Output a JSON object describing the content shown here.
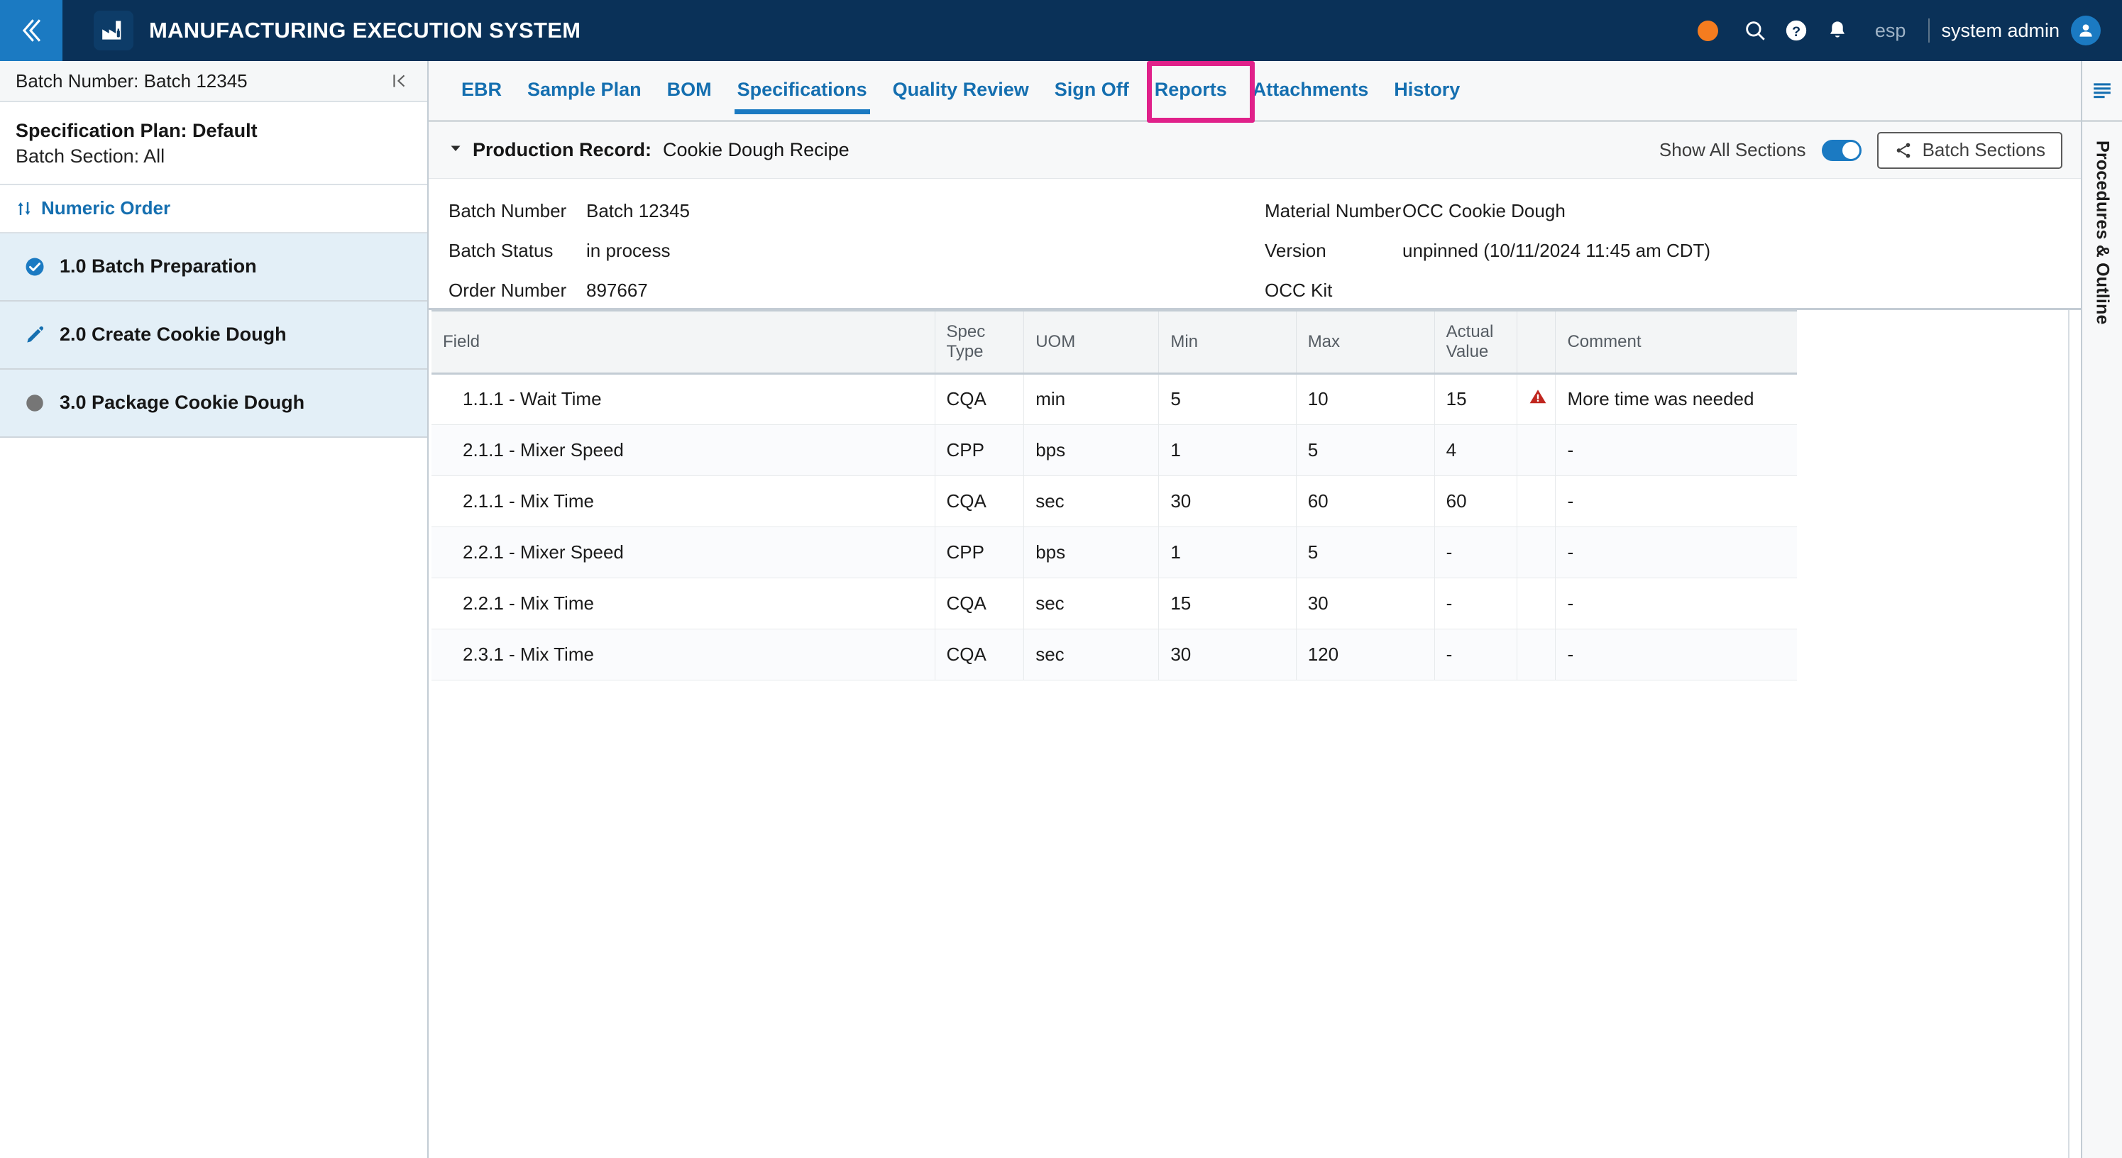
{
  "header": {
    "app_title": "MANUFACTURING EXECUTION SYSTEM",
    "collapse_icon": "chevron-double-left-icon",
    "logo_icon": "factory-icon",
    "status_dot_color": "#f57c1f",
    "search_icon": "search-icon",
    "help_icon": "help-circle-icon",
    "notifications_icon": "bell-icon",
    "language": "esp",
    "username": "system admin",
    "avatar_icon": "user-avatar-icon"
  },
  "sidebar": {
    "batch_bar_label": "Batch Number: Batch 12345",
    "collapse_icon": "collapse-panel-left-icon",
    "plan_title": "Specification Plan: Default",
    "plan_section": "Batch Section: All",
    "sort_label": "Numeric Order",
    "sort_icon": "sort-arrows-icon",
    "items": [
      {
        "label": "1.0 Batch Preparation",
        "icon": "check-circle-icon",
        "status": "complete"
      },
      {
        "label": "2.0 Create Cookie Dough",
        "icon": "pencil-icon",
        "status": "in-progress"
      },
      {
        "label": "3.0 Package Cookie Dough",
        "icon": "gray-circle-icon",
        "status": "not-started"
      }
    ]
  },
  "tabs": {
    "items": [
      {
        "label": "EBR",
        "active": false
      },
      {
        "label": "Sample Plan",
        "active": false
      },
      {
        "label": "BOM",
        "active": false
      },
      {
        "label": "Specifications",
        "active": true
      },
      {
        "label": "Quality Review",
        "active": false
      },
      {
        "label": "Sign Off",
        "active": false
      },
      {
        "label": "Reports",
        "active": false
      },
      {
        "label": "Attachments",
        "active": false
      },
      {
        "label": "History",
        "active": false
      }
    ],
    "highlight_color": "#e0218a",
    "active_underline_color": "#1b7ac2"
  },
  "record_bar": {
    "caret_icon": "caret-down-icon",
    "label": "Production Record:",
    "value": "Cookie Dough Recipe",
    "show_all_label": "Show All Sections",
    "toggle_on": true,
    "batch_sections_label": "Batch Sections",
    "share_icon": "share-nodes-icon"
  },
  "info": {
    "left": [
      {
        "key": "Batch Number",
        "value": "Batch 12345"
      },
      {
        "key": "Batch Status",
        "value": "in process"
      },
      {
        "key": "Order Number",
        "value": "897667"
      }
    ],
    "right": [
      {
        "key": "Material Number",
        "value": "OCC Cookie Dough"
      },
      {
        "key": "Version",
        "value": "unpinned (10/11/2024 11:45 am CDT)"
      },
      {
        "key": "OCC Kit",
        "value": ""
      }
    ]
  },
  "spec_table": {
    "columns": [
      "Field",
      "Spec Type",
      "UOM",
      "Min",
      "Max",
      "Actual Value",
      "",
      "Comment"
    ],
    "warning_icon": "warning-triangle-icon",
    "warning_color": "#c0261f",
    "rows": [
      {
        "field": "1.1.1 - Wait Time",
        "spec_type": "CQA",
        "uom": "min",
        "min": "5",
        "max": "10",
        "actual": "15",
        "warning": true,
        "comment": "More time was needed"
      },
      {
        "field": "2.1.1 - Mixer Speed",
        "spec_type": "CPP",
        "uom": "bps",
        "min": "1",
        "max": "5",
        "actual": "4",
        "warning": false,
        "comment": "-"
      },
      {
        "field": "2.1.1 - Mix Time",
        "spec_type": "CQA",
        "uom": "sec",
        "min": "30",
        "max": "60",
        "actual": "60",
        "warning": false,
        "comment": "-"
      },
      {
        "field": "2.2.1 - Mixer Speed",
        "spec_type": "CPP",
        "uom": "bps",
        "min": "1",
        "max": "5",
        "actual": "-",
        "warning": false,
        "comment": "-"
      },
      {
        "field": "2.2.1 - Mix Time",
        "spec_type": "CQA",
        "uom": "sec",
        "min": "15",
        "max": "30",
        "actual": "-",
        "warning": false,
        "comment": "-"
      },
      {
        "field": "2.3.1 - Mix Time",
        "spec_type": "CQA",
        "uom": "sec",
        "min": "30",
        "max": "120",
        "actual": "-",
        "warning": false,
        "comment": "-"
      }
    ]
  },
  "right_rail": {
    "menu_icon": "outline-list-icon",
    "title": "Procedures & Outline"
  }
}
